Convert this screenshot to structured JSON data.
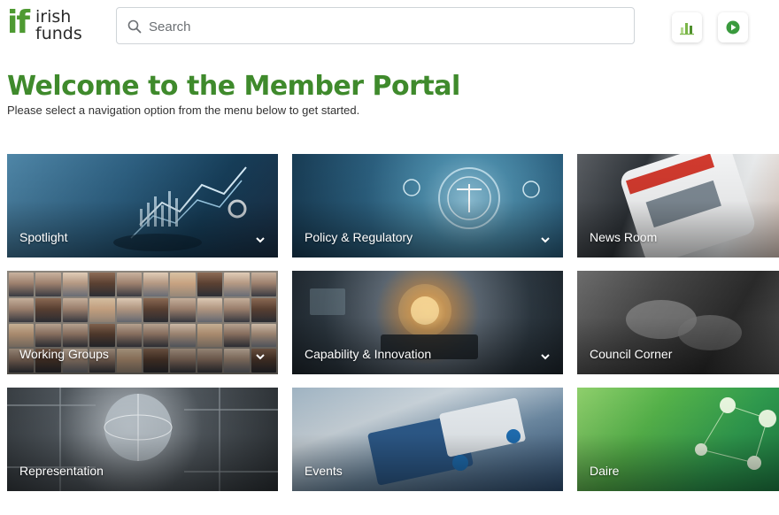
{
  "logo": {
    "mark": "if",
    "line1": "irish",
    "line2": "funds"
  },
  "search": {
    "placeholder": "Search",
    "value": ""
  },
  "header_buttons": [
    {
      "icon": "bar-chart-icon",
      "color": "#7ab648"
    },
    {
      "icon": "play-icon",
      "color": "#3a9a3e"
    }
  ],
  "page": {
    "title": "Welcome to the Member Portal",
    "subtitle": "Please select a navigation option from the menu below to get started."
  },
  "tiles": [
    {
      "label": "Spotlight",
      "expandable": true
    },
    {
      "label": "Policy & Regulatory",
      "expandable": true
    },
    {
      "label": "News Room",
      "expandable": false
    },
    {
      "label": "Working Groups",
      "expandable": true
    },
    {
      "label": "Capability & Innovation",
      "expandable": true
    },
    {
      "label": "Council Corner",
      "expandable": false
    },
    {
      "label": "Representation",
      "expandable": false
    },
    {
      "label": "Events",
      "expandable": false
    },
    {
      "label": "Daire",
      "expandable": false
    }
  ],
  "colors": {
    "brand_green": "#3f8a2c",
    "logo_green": "#4e9a32",
    "tile_text": "#ffffff"
  }
}
